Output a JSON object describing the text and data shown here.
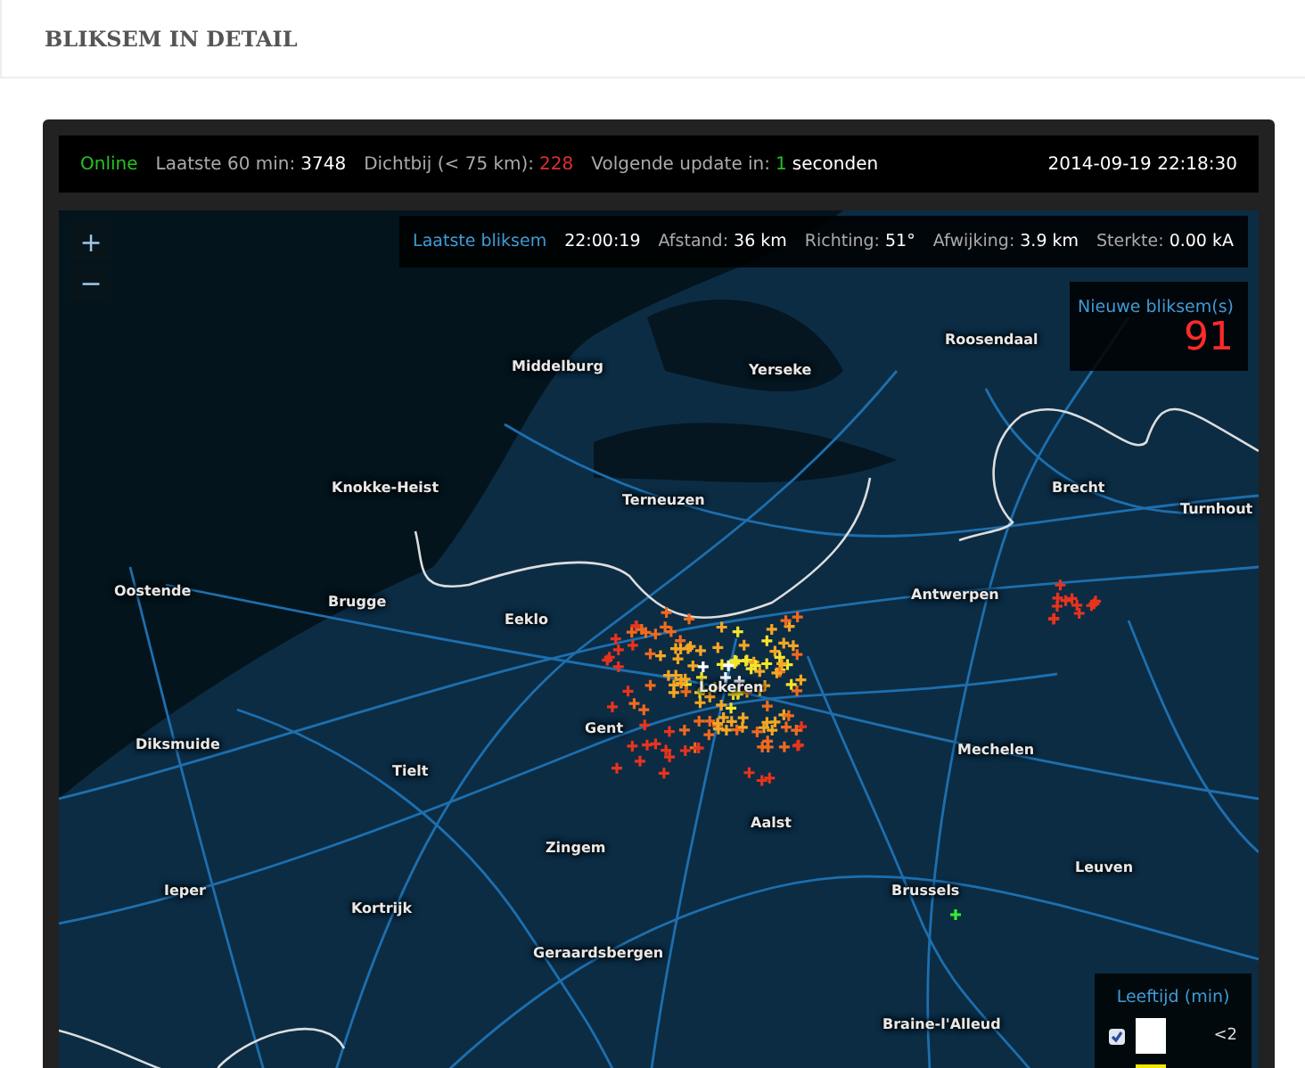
{
  "page_title": "BLIKSEM IN DETAIL",
  "status_bar": {
    "state": {
      "text": "Online",
      "color": "#22c322"
    },
    "items": [
      {
        "label": "Laatste 60 min:",
        "value": "3748",
        "color": "#ffffff"
      },
      {
        "label": "Dichtbij (< 75 km):",
        "value": "228",
        "color": "#e03030"
      },
      {
        "label": "Volgende update in:",
        "value": "1",
        "color": "#22c322",
        "unit": "seconden"
      }
    ],
    "datetime": "2014-09-19 22:18:30"
  },
  "zoom_buttons": [
    "+",
    "−"
  ],
  "last_strike": {
    "title": "Laatste bliksem",
    "time": "22:00:19",
    "fields": [
      {
        "label": "Afstand:",
        "value": "36 km"
      },
      {
        "label": "Richting:",
        "value": "51°"
      },
      {
        "label": "Afwijking:",
        "value": "3.9 km"
      },
      {
        "label": "Sterkte:",
        "value": "0.00 kA"
      }
    ]
  },
  "new_strikes": {
    "label": "Nieuwe bliksem(s)",
    "count": "91"
  },
  "map_labels": [
    "Middelburg",
    "Yerseke",
    "Roosendaal",
    "Knokke-Heist",
    "Terneuzen",
    "Brecht",
    "Turnhout",
    "Oostende",
    "Brugge",
    "Eeklo",
    "Antwerpen",
    "Lokeren",
    "Gent",
    "Diksmuide",
    "Tielt",
    "Mechelen",
    "Aalst",
    "Zingem",
    "Leuven",
    "Ieper",
    "Kortrijk",
    "Brussels",
    "Geraardsbergen",
    "Braine-l'Alleud"
  ],
  "legend": {
    "title": "Leeftijd (min)",
    "rows": [
      {
        "checked": true,
        "color": "#ffffff",
        "label": "<2"
      },
      {
        "color": "#f2e600"
      }
    ]
  }
}
